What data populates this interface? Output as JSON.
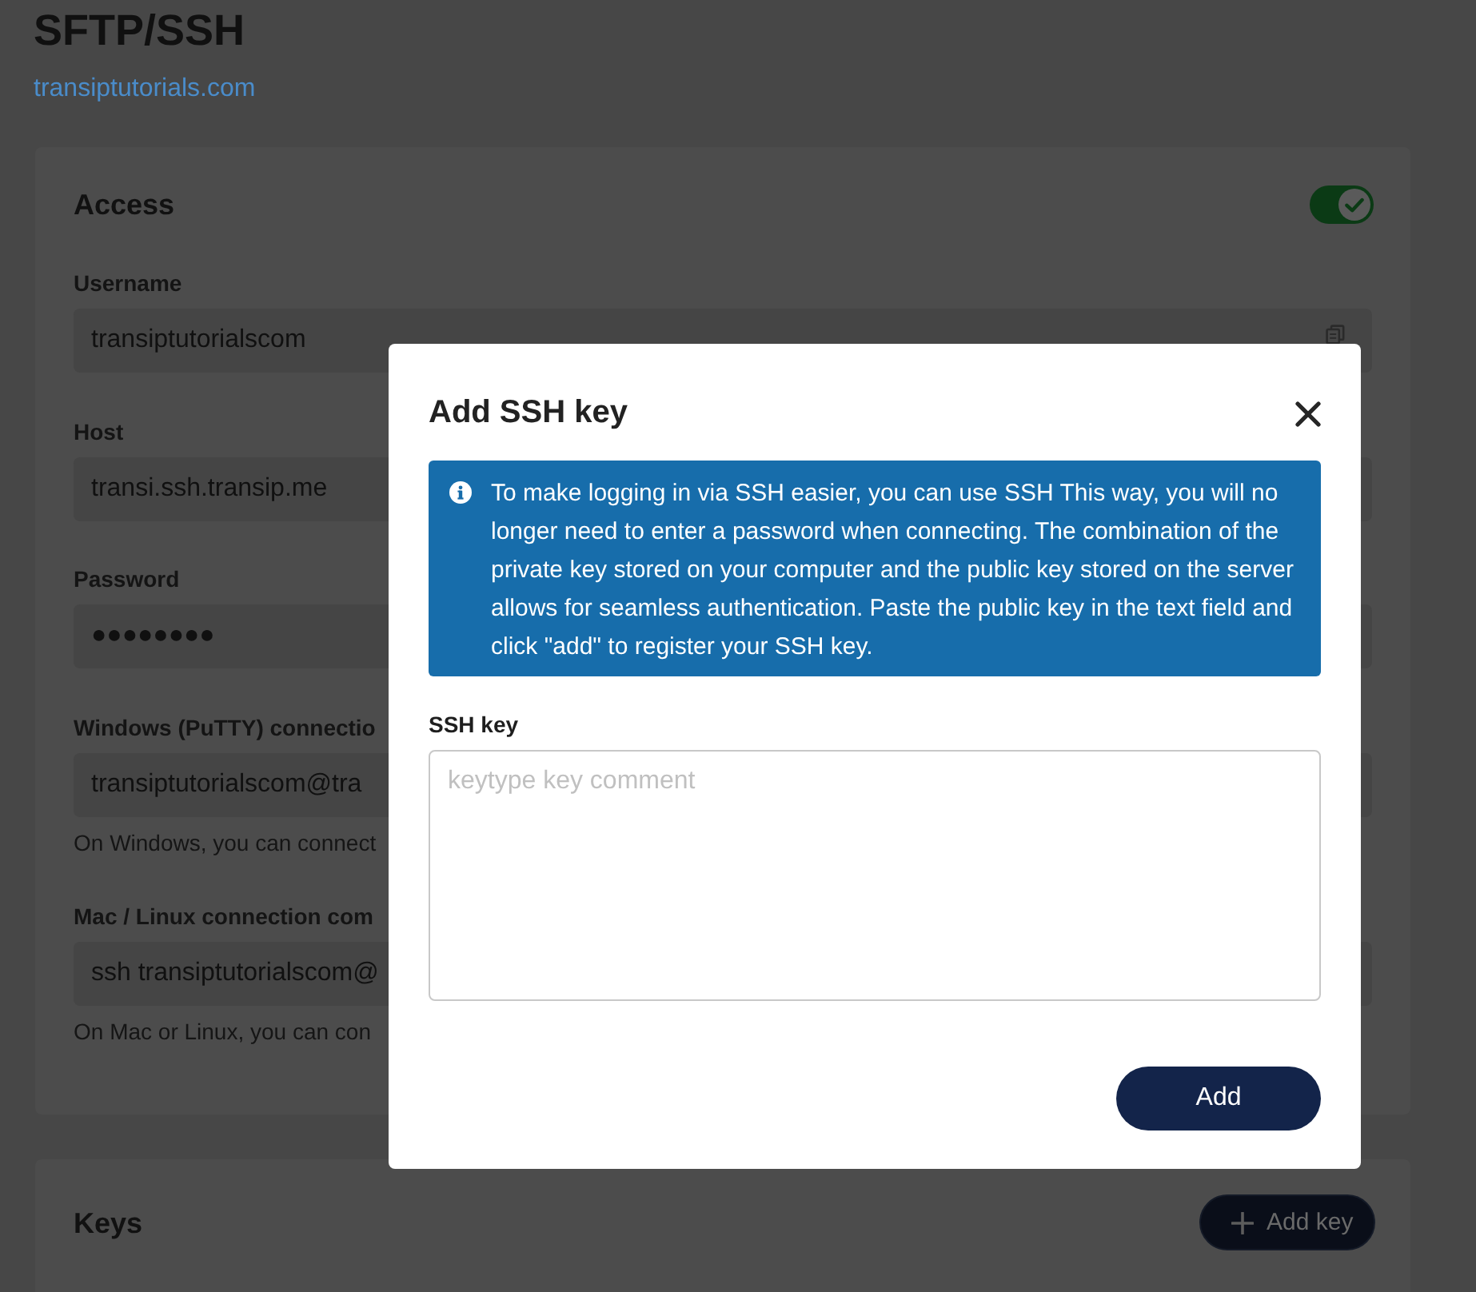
{
  "page": {
    "title": "SFTP/SSH",
    "domain_link": "transiptutorials.com"
  },
  "access": {
    "title": "Access",
    "enabled": true,
    "fields": [
      {
        "label": "Username",
        "value": "transiptutorialscom",
        "copyable": true
      },
      {
        "label": "Host",
        "value": "transi.ssh.transip.me",
        "copyable": false
      },
      {
        "label": "Password",
        "value": "●●●●●●●●",
        "copyable": false
      },
      {
        "label": "Windows (PuTTY) connectio",
        "value": "transiptutorialscom@tra",
        "copyable": false,
        "hint": "On Windows, you can connect"
      },
      {
        "label": "Mac / Linux connection com",
        "value": "ssh transiptutorialscom@",
        "copyable": false,
        "hint": "On Mac or Linux, you can con"
      }
    ]
  },
  "keys": {
    "title": "Keys",
    "add_button": "Add key"
  },
  "modal": {
    "title": "Add SSH key",
    "info": "To make logging in via SSH easier, you can use SSH This way, you will no longer need to enter a password when connecting. The combination of the private key stored on your computer and the public key stored on the server allows for seamless authentication. Paste the public key in the text field and click \"add\" to register your SSH key.",
    "key_field": {
      "label": "SSH key",
      "placeholder": "keytype key comment"
    },
    "submit": "Add"
  }
}
